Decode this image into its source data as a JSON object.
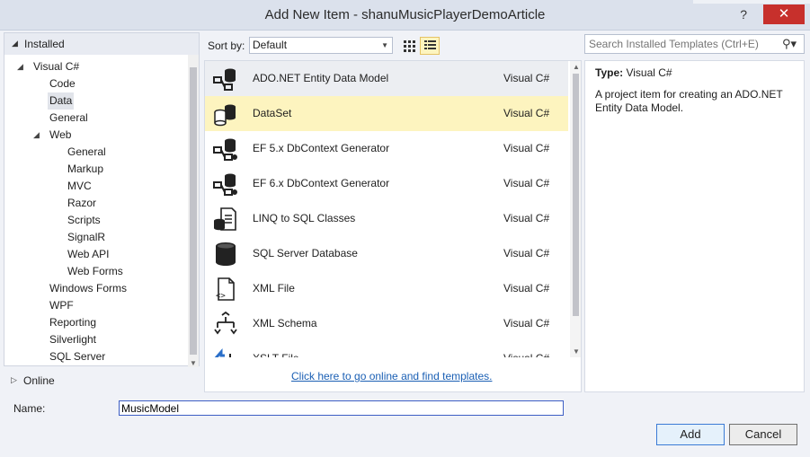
{
  "window": {
    "title": "Add New Item - shanuMusicPlayerDemoArticle",
    "help_glyph": "?",
    "close_glyph": "✕"
  },
  "left": {
    "installed_label": "Installed",
    "online_label": "Online",
    "tree": [
      {
        "label": "Visual C#",
        "level": 0,
        "expanded": true,
        "selected": false
      },
      {
        "label": "Code",
        "level": 1,
        "expanded": false,
        "selected": false
      },
      {
        "label": "Data",
        "level": 1,
        "expanded": false,
        "selected": true
      },
      {
        "label": "General",
        "level": 1,
        "expanded": false,
        "selected": false
      },
      {
        "label": "Web",
        "level": 1,
        "expanded": true,
        "selected": false
      },
      {
        "label": "General",
        "level": 2,
        "expanded": false,
        "selected": false
      },
      {
        "label": "Markup",
        "level": 2,
        "expanded": false,
        "selected": false
      },
      {
        "label": "MVC",
        "level": 2,
        "expanded": false,
        "selected": false
      },
      {
        "label": "Razor",
        "level": 2,
        "expanded": false,
        "selected": false
      },
      {
        "label": "Scripts",
        "level": 2,
        "expanded": false,
        "selected": false
      },
      {
        "label": "SignalR",
        "level": 2,
        "expanded": false,
        "selected": false
      },
      {
        "label": "Web API",
        "level": 2,
        "expanded": false,
        "selected": false
      },
      {
        "label": "Web Forms",
        "level": 2,
        "expanded": false,
        "selected": false
      },
      {
        "label": "Windows Forms",
        "level": 1,
        "expanded": false,
        "selected": false
      },
      {
        "label": "WPF",
        "level": 1,
        "expanded": false,
        "selected": false
      },
      {
        "label": "Reporting",
        "level": 1,
        "expanded": false,
        "selected": false
      },
      {
        "label": "Silverlight",
        "level": 1,
        "expanded": false,
        "selected": false
      },
      {
        "label": "SQL Server",
        "level": 1,
        "expanded": false,
        "selected": false
      }
    ]
  },
  "toolbar": {
    "sort_label": "Sort by:",
    "sort_value": "Default",
    "search_placeholder": "Search Installed Templates (Ctrl+E)"
  },
  "templates": [
    {
      "name": "ADO.NET Entity Data Model",
      "lang": "Visual C#",
      "icon": "entity-model-icon",
      "state": "hover"
    },
    {
      "name": "DataSet",
      "lang": "Visual C#",
      "icon": "dataset-icon",
      "state": "selected"
    },
    {
      "name": "EF 5.x DbContext Generator",
      "lang": "Visual C#",
      "icon": "dbcontext-generator-icon",
      "state": "normal"
    },
    {
      "name": "EF 6.x DbContext Generator",
      "lang": "Visual C#",
      "icon": "dbcontext-generator-icon",
      "state": "normal"
    },
    {
      "name": "LINQ to SQL Classes",
      "lang": "Visual C#",
      "icon": "linq-to-sql-icon",
      "state": "normal"
    },
    {
      "name": "SQL Server Database",
      "lang": "Visual C#",
      "icon": "database-icon",
      "state": "normal"
    },
    {
      "name": "XML File",
      "lang": "Visual C#",
      "icon": "xml-file-icon",
      "state": "normal"
    },
    {
      "name": "XML Schema",
      "lang": "Visual C#",
      "icon": "xml-schema-icon",
      "state": "normal"
    },
    {
      "name": "XSLT File",
      "lang": "Visual C#",
      "icon": "xslt-file-icon",
      "state": "normal"
    }
  ],
  "online_link": "Click here to go online and find templates.",
  "details": {
    "type_label": "Type:",
    "type_value": "Visual C#",
    "description": "A project item for creating an ADO.NET Entity Data Model."
  },
  "name_field": {
    "label": "Name:",
    "value": "MusicModel"
  },
  "buttons": {
    "add": "Add",
    "cancel": "Cancel"
  },
  "colors": {
    "selection": "#fdf4bf",
    "link": "#1a5fb4",
    "close": "#c7302c"
  }
}
